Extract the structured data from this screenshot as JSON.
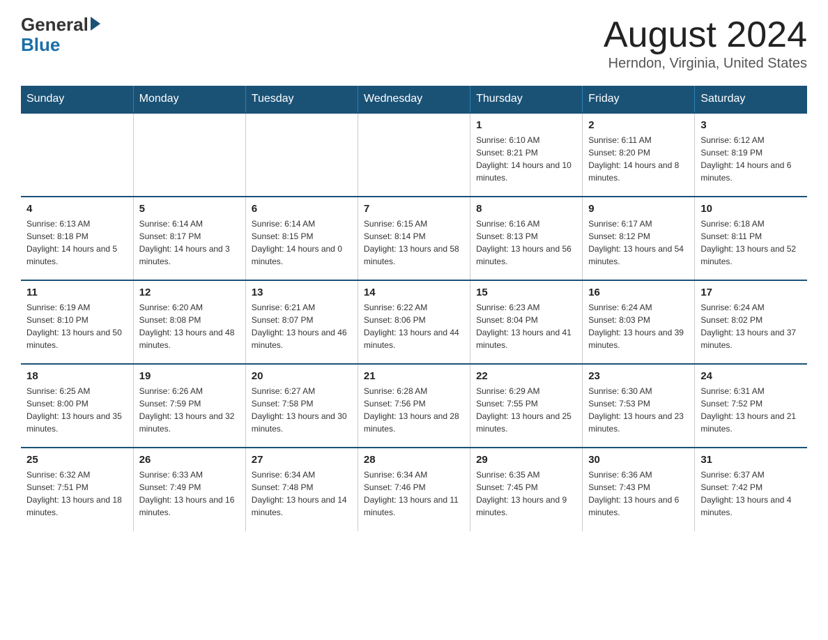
{
  "header": {
    "logo_general": "General",
    "logo_blue": "Blue",
    "month_title": "August 2024",
    "location": "Herndon, Virginia, United States"
  },
  "weekdays": [
    "Sunday",
    "Monday",
    "Tuesday",
    "Wednesday",
    "Thursday",
    "Friday",
    "Saturday"
  ],
  "weeks": [
    [
      {
        "day": "",
        "info": ""
      },
      {
        "day": "",
        "info": ""
      },
      {
        "day": "",
        "info": ""
      },
      {
        "day": "",
        "info": ""
      },
      {
        "day": "1",
        "info": "Sunrise: 6:10 AM\nSunset: 8:21 PM\nDaylight: 14 hours and 10 minutes."
      },
      {
        "day": "2",
        "info": "Sunrise: 6:11 AM\nSunset: 8:20 PM\nDaylight: 14 hours and 8 minutes."
      },
      {
        "day": "3",
        "info": "Sunrise: 6:12 AM\nSunset: 8:19 PM\nDaylight: 14 hours and 6 minutes."
      }
    ],
    [
      {
        "day": "4",
        "info": "Sunrise: 6:13 AM\nSunset: 8:18 PM\nDaylight: 14 hours and 5 minutes."
      },
      {
        "day": "5",
        "info": "Sunrise: 6:14 AM\nSunset: 8:17 PM\nDaylight: 14 hours and 3 minutes."
      },
      {
        "day": "6",
        "info": "Sunrise: 6:14 AM\nSunset: 8:15 PM\nDaylight: 14 hours and 0 minutes."
      },
      {
        "day": "7",
        "info": "Sunrise: 6:15 AM\nSunset: 8:14 PM\nDaylight: 13 hours and 58 minutes."
      },
      {
        "day": "8",
        "info": "Sunrise: 6:16 AM\nSunset: 8:13 PM\nDaylight: 13 hours and 56 minutes."
      },
      {
        "day": "9",
        "info": "Sunrise: 6:17 AM\nSunset: 8:12 PM\nDaylight: 13 hours and 54 minutes."
      },
      {
        "day": "10",
        "info": "Sunrise: 6:18 AM\nSunset: 8:11 PM\nDaylight: 13 hours and 52 minutes."
      }
    ],
    [
      {
        "day": "11",
        "info": "Sunrise: 6:19 AM\nSunset: 8:10 PM\nDaylight: 13 hours and 50 minutes."
      },
      {
        "day": "12",
        "info": "Sunrise: 6:20 AM\nSunset: 8:08 PM\nDaylight: 13 hours and 48 minutes."
      },
      {
        "day": "13",
        "info": "Sunrise: 6:21 AM\nSunset: 8:07 PM\nDaylight: 13 hours and 46 minutes."
      },
      {
        "day": "14",
        "info": "Sunrise: 6:22 AM\nSunset: 8:06 PM\nDaylight: 13 hours and 44 minutes."
      },
      {
        "day": "15",
        "info": "Sunrise: 6:23 AM\nSunset: 8:04 PM\nDaylight: 13 hours and 41 minutes."
      },
      {
        "day": "16",
        "info": "Sunrise: 6:24 AM\nSunset: 8:03 PM\nDaylight: 13 hours and 39 minutes."
      },
      {
        "day": "17",
        "info": "Sunrise: 6:24 AM\nSunset: 8:02 PM\nDaylight: 13 hours and 37 minutes."
      }
    ],
    [
      {
        "day": "18",
        "info": "Sunrise: 6:25 AM\nSunset: 8:00 PM\nDaylight: 13 hours and 35 minutes."
      },
      {
        "day": "19",
        "info": "Sunrise: 6:26 AM\nSunset: 7:59 PM\nDaylight: 13 hours and 32 minutes."
      },
      {
        "day": "20",
        "info": "Sunrise: 6:27 AM\nSunset: 7:58 PM\nDaylight: 13 hours and 30 minutes."
      },
      {
        "day": "21",
        "info": "Sunrise: 6:28 AM\nSunset: 7:56 PM\nDaylight: 13 hours and 28 minutes."
      },
      {
        "day": "22",
        "info": "Sunrise: 6:29 AM\nSunset: 7:55 PM\nDaylight: 13 hours and 25 minutes."
      },
      {
        "day": "23",
        "info": "Sunrise: 6:30 AM\nSunset: 7:53 PM\nDaylight: 13 hours and 23 minutes."
      },
      {
        "day": "24",
        "info": "Sunrise: 6:31 AM\nSunset: 7:52 PM\nDaylight: 13 hours and 21 minutes."
      }
    ],
    [
      {
        "day": "25",
        "info": "Sunrise: 6:32 AM\nSunset: 7:51 PM\nDaylight: 13 hours and 18 minutes."
      },
      {
        "day": "26",
        "info": "Sunrise: 6:33 AM\nSunset: 7:49 PM\nDaylight: 13 hours and 16 minutes."
      },
      {
        "day": "27",
        "info": "Sunrise: 6:34 AM\nSunset: 7:48 PM\nDaylight: 13 hours and 14 minutes."
      },
      {
        "day": "28",
        "info": "Sunrise: 6:34 AM\nSunset: 7:46 PM\nDaylight: 13 hours and 11 minutes."
      },
      {
        "day": "29",
        "info": "Sunrise: 6:35 AM\nSunset: 7:45 PM\nDaylight: 13 hours and 9 minutes."
      },
      {
        "day": "30",
        "info": "Sunrise: 6:36 AM\nSunset: 7:43 PM\nDaylight: 13 hours and 6 minutes."
      },
      {
        "day": "31",
        "info": "Sunrise: 6:37 AM\nSunset: 7:42 PM\nDaylight: 13 hours and 4 minutes."
      }
    ]
  ]
}
